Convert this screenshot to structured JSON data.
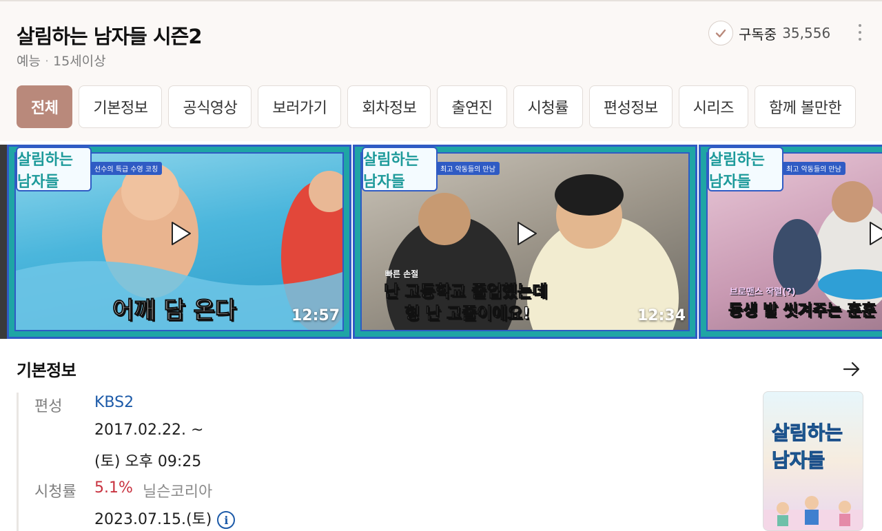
{
  "header": {
    "title": "살림하는 남자들 시즌2",
    "genre": "예능",
    "rating": "15세이상",
    "subscribe_label": "구독중",
    "subscriber_count": "35,556"
  },
  "tabs": [
    {
      "label": "전체",
      "active": true
    },
    {
      "label": "기본정보"
    },
    {
      "label": "공식영상"
    },
    {
      "label": "보러가기"
    },
    {
      "label": "회차정보"
    },
    {
      "label": "출연진"
    },
    {
      "label": "시청률"
    },
    {
      "label": "편성정보"
    },
    {
      "label": "시리즈"
    },
    {
      "label": "함께 볼만한"
    }
  ],
  "videos": [
    {
      "caption": "어깨 담 온다",
      "duration": "12:57",
      "tagline": "선수의 특급 수영 코칭"
    },
    {
      "caption_line1": "난 고등학교 졸업했는데",
      "caption_line2": "형 난 고졸이에요!",
      "caption_small": "빠른 손절",
      "duration": "12:34",
      "tagline": "최고 악동들의 만남"
    },
    {
      "caption_small": "브로맨스 작렬(?)",
      "caption": "동생 발 씻겨주는 훈훈",
      "duration": "",
      "tagline": "최고 악동들의 만남"
    }
  ],
  "logo_text": "살림하는 남자들",
  "basic_info": {
    "section_title": "기본정보",
    "broadcast_label": "편성",
    "broadcaster": "KBS2",
    "start_date": "2017.02.22. ~",
    "schedule": "(토) 오후 09:25",
    "rating_label": "시청률",
    "rating_value": "5.1%",
    "rating_source": "닐슨코리아",
    "rating_date": "2023.07.15.(토)",
    "info_icon": "i"
  },
  "colors": {
    "accent": "#b9897b",
    "link": "#1c5aa8",
    "rating": "#c8323f",
    "card_border": "#2f5bc4",
    "card_frame": "#1fa5a5"
  }
}
